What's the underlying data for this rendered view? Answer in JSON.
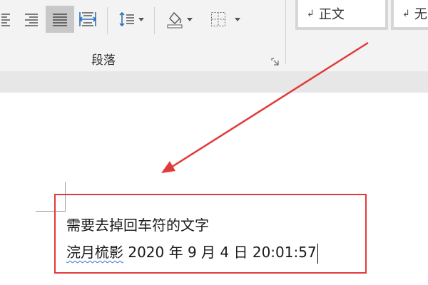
{
  "ribbon": {
    "paragraph_group_label": "段落",
    "tools": [
      {
        "name": "align-left-icon"
      },
      {
        "name": "align-right-icon"
      },
      {
        "name": "justify-icon",
        "active": true
      },
      {
        "name": "distributed-icon"
      },
      {
        "name": "line-spacing-icon"
      },
      {
        "name": "shading-icon"
      },
      {
        "name": "borders-icon"
      }
    ],
    "styles": [
      {
        "mark": "↲",
        "label": "正文"
      },
      {
        "mark": "↲",
        "label": "无"
      }
    ]
  },
  "document": {
    "lines": [
      {
        "text": "需要去掉回车符的文字"
      },
      {
        "spellcheck": "浣月梳影",
        "rest": "  2020 年 9 月 4 日 20:01:57"
      }
    ]
  },
  "colors": {
    "annotation": "#e23a3a",
    "ribbon_bg": "#f3f3f3",
    "active_button": "#c8c8c8"
  }
}
